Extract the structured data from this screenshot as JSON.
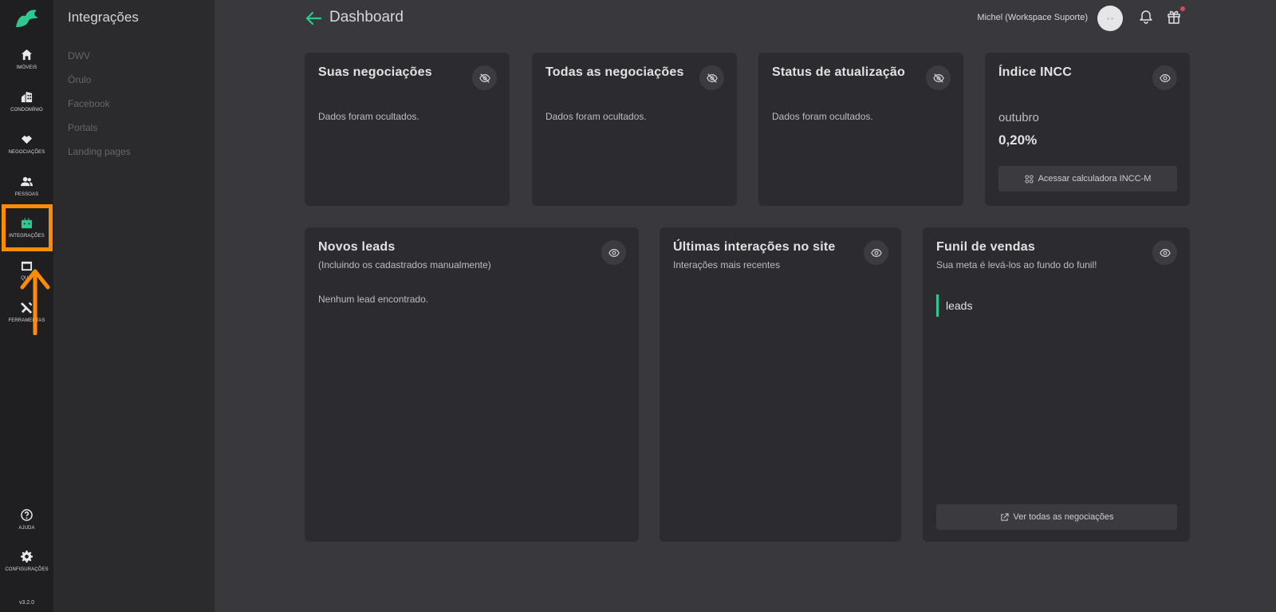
{
  "rail": {
    "items": [
      {
        "label": "IMÓVEIS",
        "icon": "home-icon"
      },
      {
        "label": "CONDOMÍNIO",
        "icon": "building-icon"
      },
      {
        "label": "NEGOCIAÇÕES",
        "icon": "handshake-icon"
      },
      {
        "label": "PESSOAS",
        "icon": "people-icon"
      },
      {
        "label": "INTEGRAÇÕES",
        "icon": "integrations-icon",
        "active": true
      },
      {
        "label": "QU...",
        "icon": "calendar-icon"
      },
      {
        "label": "FERRAMENTAS",
        "icon": "tools-icon"
      },
      {
        "label": "AJUDA",
        "icon": "help-icon"
      },
      {
        "label": "CONFIGURAÇÕES",
        "icon": "gear-icon"
      }
    ],
    "version": "v3.2.0",
    "accent": "#2ec98e",
    "highlight_color": "#ff8c00"
  },
  "submenu": {
    "title": "Integrações",
    "items": [
      "DWV",
      "Órulo",
      "Facebook",
      "Portals",
      "Landing pages"
    ]
  },
  "header": {
    "title": "Dashboard",
    "user": "Michel (Workspace Suporte)",
    "avatar_text": "• •"
  },
  "cards": {
    "suas": {
      "title": "Suas negociações",
      "text": "Dados foram ocultados."
    },
    "todas": {
      "title": "Todas as negociações",
      "text": "Dados foram ocultados."
    },
    "status": {
      "title": "Status de atualização",
      "text": "Dados foram ocultados."
    },
    "incc": {
      "title": "Índice INCC",
      "month": "outubro",
      "value": "0,20%",
      "button": "Acessar calculadora INCC-M"
    },
    "leads": {
      "title": "Novos leads",
      "subtitle": "(Incluindo os cadastrados manualmente)",
      "text": "Nenhum lead encontrado."
    },
    "interacoes": {
      "title": "Últimas interações no site",
      "subtitle": "Interações mais recentes"
    },
    "funil": {
      "title": "Funil de vendas",
      "subtitle": "Sua meta é levá-los ao fundo do funil!",
      "stage": "leads",
      "button": "Ver todas as negociações"
    }
  }
}
